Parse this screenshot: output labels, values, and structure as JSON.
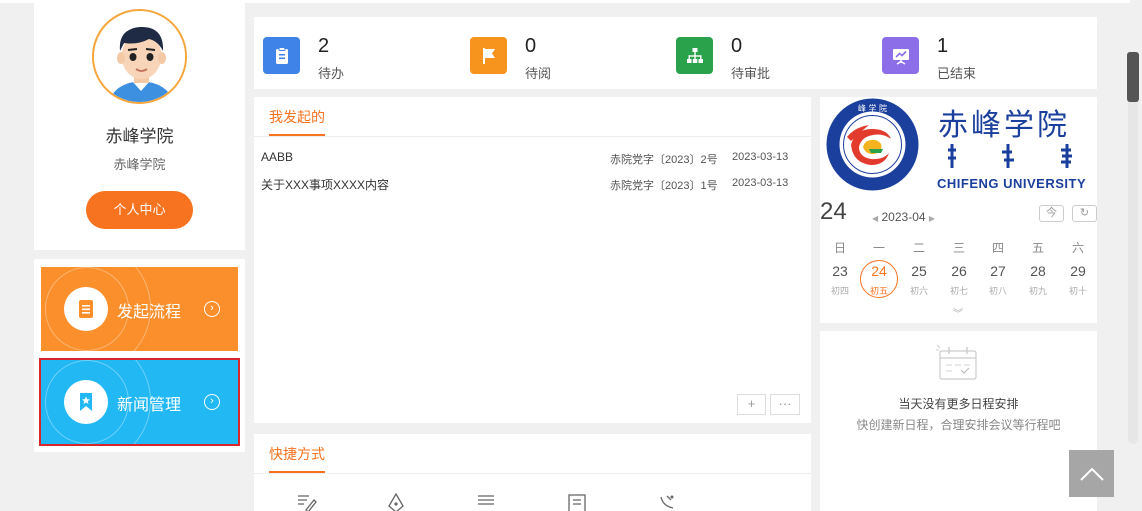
{
  "profile": {
    "name": "赤峰学院",
    "org": "赤峰学院",
    "center_button": "个人中心"
  },
  "quick_cards": [
    {
      "label": "发起流程",
      "color": "#fb8f2c",
      "icon": "document-icon"
    },
    {
      "label": "新闻管理",
      "color": "#21b8f4",
      "icon": "bookmark-star-icon"
    }
  ],
  "stats": [
    {
      "count": "2",
      "label": "待办",
      "color": "#3f83e8",
      "icon": "clipboard-icon"
    },
    {
      "count": "0",
      "label": "待阅",
      "color": "#f7941d",
      "icon": "flag-icon"
    },
    {
      "count": "0",
      "label": "待审批",
      "color": "#2aa14b",
      "icon": "org-chart-icon"
    },
    {
      "count": "1",
      "label": "已结束",
      "color": "#8b6ee8",
      "icon": "presentation-icon"
    }
  ],
  "initiated": {
    "title": "我发起的",
    "rows": [
      {
        "title": "AABB",
        "number": "赤院党字〔2023〕2号",
        "date": "2023-03-13"
      },
      {
        "title": "关于XXX事项XXXX内容",
        "number": "赤院党字〔2023〕1号",
        "date": "2023-03-13"
      }
    ],
    "add_label": "+",
    "more_label": "···"
  },
  "shortcuts": {
    "title": "快捷方式"
  },
  "logo": {
    "cn": "赤峰学院",
    "en": "CHIFENG UNIVERSITY"
  },
  "calendar": {
    "day": "24",
    "month": "2023-04",
    "today_btn": "今",
    "weekdays": [
      "日",
      "一",
      "二",
      "三",
      "四",
      "五",
      "六"
    ],
    "days": [
      {
        "d": "23",
        "l": "初四"
      },
      {
        "d": "24",
        "l": "初五"
      },
      {
        "d": "25",
        "l": "初六"
      },
      {
        "d": "26",
        "l": "初七"
      },
      {
        "d": "27",
        "l": "初八"
      },
      {
        "d": "28",
        "l": "初九"
      },
      {
        "d": "29",
        "l": "初十"
      }
    ]
  },
  "schedule": {
    "empty_title": "当天没有更多日程安排",
    "empty_hint": "快创建新日程，合理安排会议等行程吧"
  }
}
